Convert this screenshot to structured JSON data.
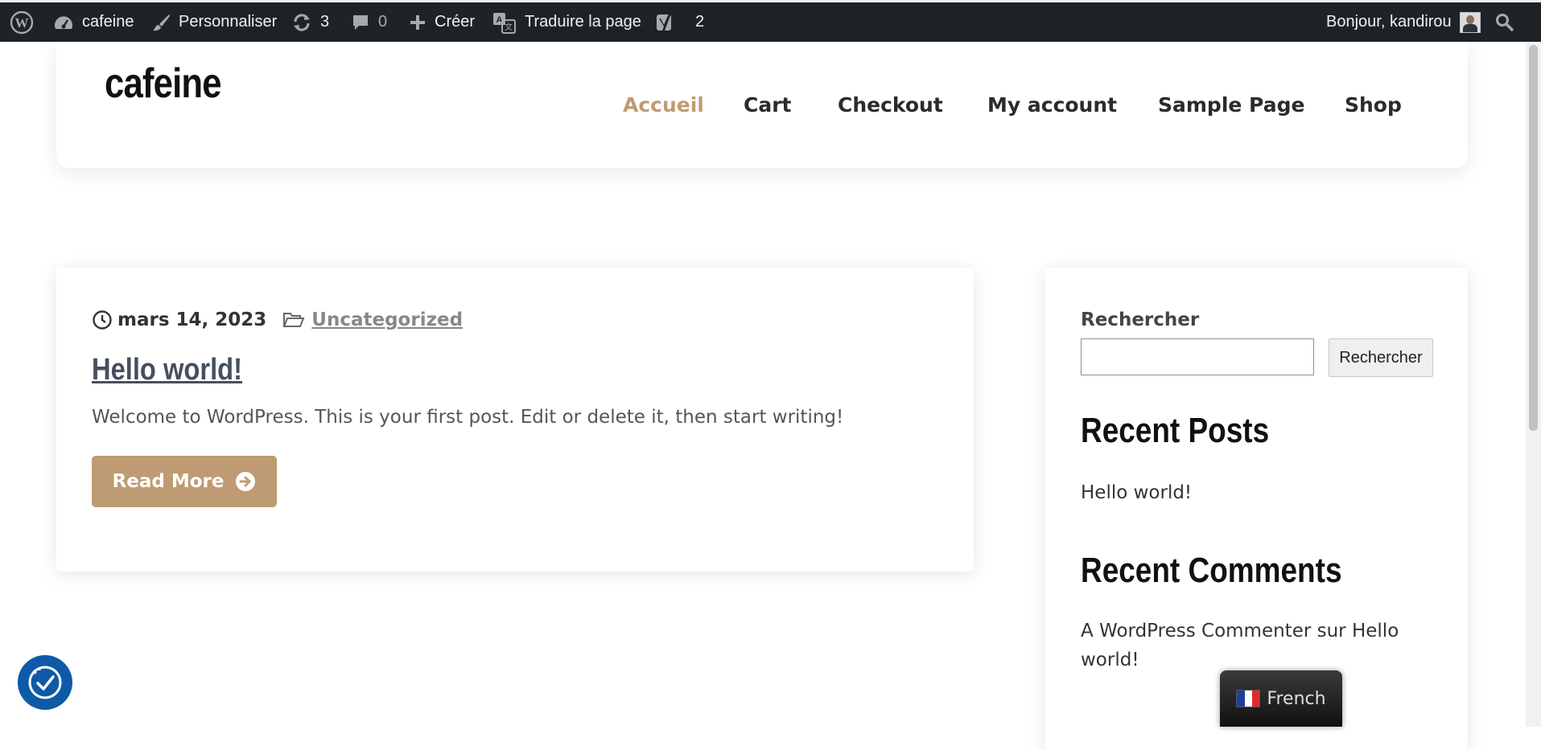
{
  "adminbar": {
    "site_name": "cafeine",
    "customize": "Personnaliser",
    "updates_count": "3",
    "comments_count": "0",
    "new": "Créer",
    "translate": "Traduire la page",
    "yoast_count": "2",
    "greeting": "Bonjour, kandirou"
  },
  "site": {
    "title": "cafeine"
  },
  "nav": {
    "items": [
      {
        "label": "Accueil"
      },
      {
        "label": "Cart"
      },
      {
        "label": "Checkout"
      },
      {
        "label": "My account"
      },
      {
        "label": "Sample Page"
      },
      {
        "label": "Shop"
      }
    ]
  },
  "post": {
    "date": "mars 14, 2023",
    "category": "Uncategorized",
    "title": "Hello world!",
    "excerpt": "Welcome to WordPress. This is your first post. Edit or delete it, then start writing!",
    "read_more": "Read More"
  },
  "sidebar": {
    "search_label": "Rechercher",
    "search_value": "",
    "search_button": "Rechercher",
    "recent_posts_title": "Recent Posts",
    "recent_posts": [
      "Hello world!"
    ],
    "recent_comments_title": "Recent Comments",
    "comment_author": "A WordPress Commenter",
    "comment_sep": "sur",
    "comment_post_line1": "Hello",
    "comment_post_line2": "world!"
  },
  "language_switcher": {
    "label": "French"
  },
  "colors": {
    "accent": "#bf9b73",
    "adminbar_bg": "#1d2327",
    "accessibility_blue": "#0e5aa7"
  }
}
